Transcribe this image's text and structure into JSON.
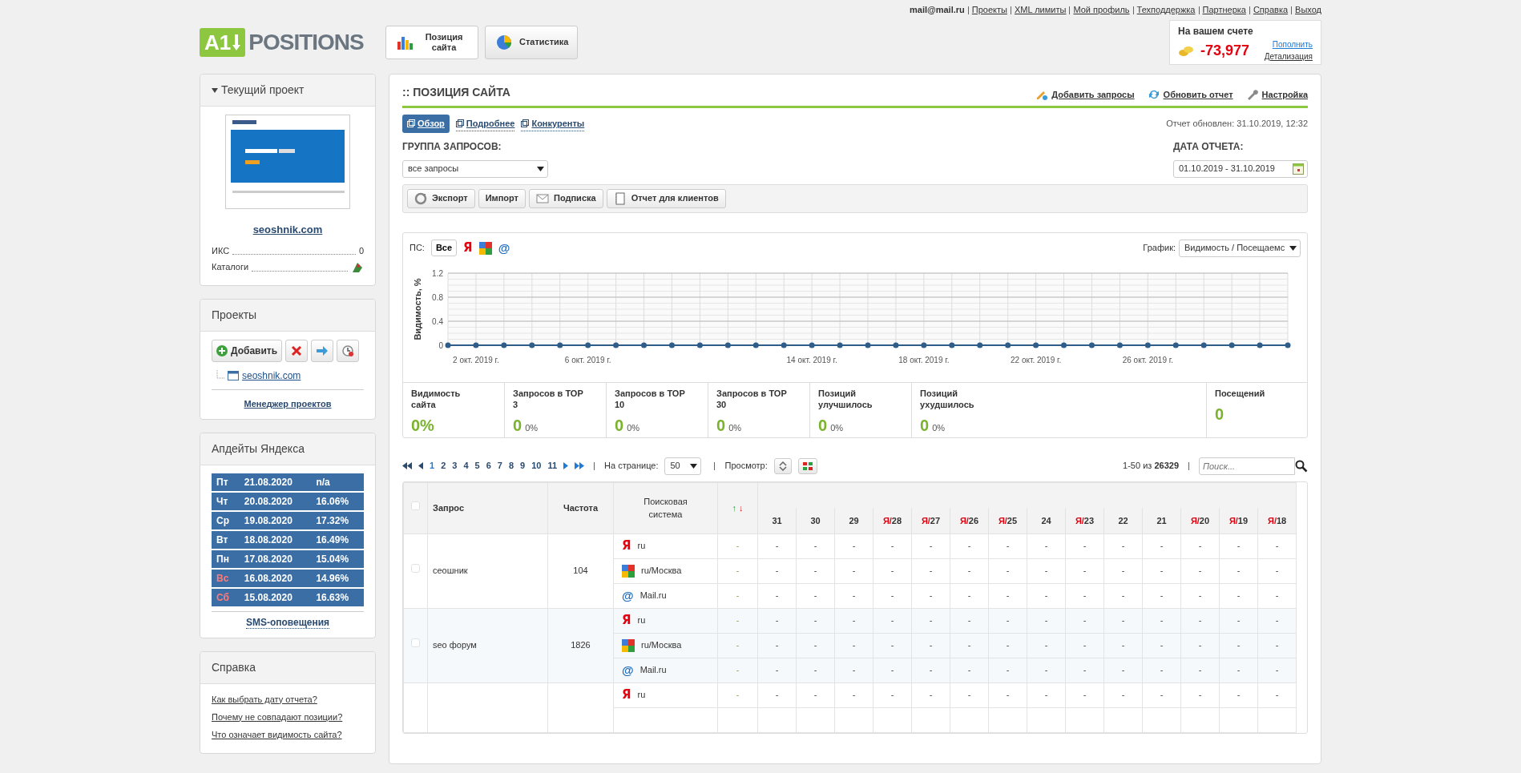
{
  "top_links": {
    "user": "mail@mail.ru",
    "links": [
      "Проекты",
      "XML лимиты",
      "Мой профиль",
      "Техподдержка",
      "Партнерка",
      "Справка",
      "Выход"
    ]
  },
  "logo": {
    "badge": "A1",
    "text": "POSITIONS"
  },
  "nav_tabs": [
    {
      "label": "Позиция сайта",
      "kind": "bars",
      "selected": true
    },
    {
      "label": "Статистика",
      "kind": "pie",
      "selected": false
    }
  ],
  "balance": {
    "title": "На вашем счете",
    "amount": "-73,977",
    "top_up": "Пополнить",
    "details": "Детализация"
  },
  "sidebar": {
    "current_project": {
      "title": "Текущий проект",
      "site": "seoshnik.com",
      "stats": [
        {
          "label": "ИКС",
          "kind": "text",
          "value": "0"
        },
        {
          "label": "Каталоги",
          "kind": "icon"
        }
      ]
    },
    "projects": {
      "title": "Проекты",
      "add": "Добавить",
      "tree": [
        {
          "label": "seoshnik.com"
        }
      ],
      "manager": "Менеджер проектов"
    },
    "updates": {
      "title": "Апдейты Яндекса",
      "rows": [
        {
          "day": "Пт",
          "date": "21.08.2020",
          "value": "n/a",
          "weekend": false
        },
        {
          "day": "Чт",
          "date": "20.08.2020",
          "value": "16.06%",
          "weekend": false
        },
        {
          "day": "Ср",
          "date": "19.08.2020",
          "value": "17.32%",
          "weekend": false
        },
        {
          "day": "Вт",
          "date": "18.08.2020",
          "value": "16.49%",
          "weekend": false
        },
        {
          "day": "Пн",
          "date": "17.08.2020",
          "value": "15.04%",
          "weekend": false
        },
        {
          "day": "Вс",
          "date": "16.08.2020",
          "value": "14.96%",
          "weekend": true
        },
        {
          "day": "Сб",
          "date": "15.08.2020",
          "value": "16.63%",
          "weekend": true
        }
      ],
      "sms": "SMS-оповещения"
    },
    "help": {
      "title": "Справка",
      "links": [
        "Как выбрать дату отчета?",
        "Почему не совпадают позиции?",
        "Что означает видимость сайта?"
      ]
    }
  },
  "main": {
    "title": ":: ПОЗИЦИЯ САЙТА",
    "actions": [
      {
        "label": "Добавить запросы",
        "kind": "add"
      },
      {
        "label": "Обновить отчет",
        "kind": "refresh"
      },
      {
        "label": "Настройка",
        "kind": "settings"
      }
    ],
    "view_tabs": [
      {
        "label": "Обзор",
        "selected": true
      },
      {
        "label": "Подробнее",
        "selected": false
      },
      {
        "label": "Конкуренты",
        "selected": false
      }
    ],
    "updated": "Отчет обновлен: 31.10.2019, 12:32",
    "group_label": "ГРУППА ЗАПРОСОВ:",
    "group_value": "все запросы",
    "date_label": "ДАТА ОТЧЕТА:",
    "date_value": "01.10.2019 - 31.10.2019",
    "toolbar": [
      {
        "label": "Экспорт",
        "kind": "export"
      },
      {
        "label": "Импорт",
        "kind": "plain"
      },
      {
        "label": "Подписка",
        "kind": "mail"
      },
      {
        "label": "Отчет для клиентов",
        "kind": "doc"
      }
    ],
    "chart_panel": {
      "ps_label": "ПС:",
      "engines": [
        {
          "kind": "all",
          "label": "Все",
          "selected": true
        },
        {
          "kind": "yandex",
          "glyph": "Я",
          "selected": false
        },
        {
          "kind": "google",
          "selected": false
        },
        {
          "kind": "mail",
          "glyph": "@",
          "selected": false
        }
      ],
      "graph_label": "График:",
      "graph_value": "Видимость / Посещаемс",
      "chart_data": {
        "type": "line",
        "ylabel": "Видимость, %",
        "categories": [
          null,
          "2 окт. 2019 г.",
          null,
          null,
          null,
          "6 окт. 2019 г.",
          null,
          null,
          null,
          null,
          null,
          null,
          null,
          "14 окт. 2019 г.",
          null,
          null,
          null,
          "18 окт. 2019 г.",
          null,
          null,
          null,
          "22 окт. 2019 г.",
          null,
          null,
          null,
          "26 окт. 2019 г.",
          null,
          null,
          null,
          null,
          null
        ],
        "series": [
          {
            "color": "#2f5d8a",
            "marker": true,
            "values": [
              0,
              0,
              0,
              0,
              0,
              0,
              0,
              0,
              0,
              0,
              0,
              0,
              0,
              0,
              0,
              0,
              0,
              0,
              0,
              0,
              0,
              0,
              0,
              0,
              0,
              0,
              0,
              0,
              0,
              0,
              0
            ]
          }
        ],
        "ylim": [
          0,
          1.2
        ],
        "yticks": [
          0,
          0.4,
          0.8,
          1.2
        ],
        "grid": true
      },
      "stats": [
        {
          "label": "Видимость сайта",
          "value": "0%"
        },
        {
          "label": "Запросов в ТОР 3",
          "value": "0",
          "percent": "0%"
        },
        {
          "label": "Запросов в ТОР 10",
          "value": "0",
          "percent": "0%"
        },
        {
          "label": "Запросов в ТОР 30",
          "value": "0",
          "percent": "0%"
        },
        {
          "label": "Позиций улучшилось",
          "value": "0",
          "percent": "0%"
        },
        {
          "label": "Позиций ухудшилось",
          "value": "0",
          "percent": "0%"
        },
        {
          "label": "Посещений",
          "value": "0"
        }
      ]
    },
    "pagination": {
      "pages": [
        {
          "label": "1",
          "selected": true
        },
        {
          "label": "2",
          "selected": false
        },
        {
          "label": "3",
          "selected": false
        },
        {
          "label": "4",
          "selected": false
        },
        {
          "label": "5",
          "selected": false
        },
        {
          "label": "6",
          "selected": false
        },
        {
          "label": "7",
          "selected": false
        },
        {
          "label": "8",
          "selected": false
        },
        {
          "label": "9",
          "selected": false
        },
        {
          "label": "10",
          "selected": false
        },
        {
          "label": "11",
          "selected": false
        }
      ],
      "per_page_label": "На странице:",
      "per_page": "50",
      "view_label": "Просмотр:",
      "range": "1-50 из **26329**",
      "search_placeholder": "Поиск..."
    },
    "table": {
      "select_all": false,
      "columns": {
        "query": "Запрос",
        "freq": "Частота",
        "engine": "Поисковая система",
        "change_up": "↑",
        "change_down": "↓"
      },
      "days": [
        {
          "day": "31"
        },
        {
          "day": "30"
        },
        {
          "day": "29"
        },
        {
          "prefix": "Я/",
          "day": "28"
        },
        {
          "prefix": "Я/",
          "day": "27"
        },
        {
          "prefix": "Я/",
          "day": "26"
        },
        {
          "prefix": "Я/",
          "day": "25"
        },
        {
          "day": "24"
        },
        {
          "prefix": "Я/",
          "day": "23"
        },
        {
          "day": "22"
        },
        {
          "day": "21"
        },
        {
          "prefix": "Я/",
          "day": "20"
        },
        {
          "prefix": "Я/",
          "day": "19"
        },
        {
          "prefix": "Я/",
          "day": "18"
        }
      ],
      "rows": [
        {
          "query": "сеошник",
          "freq": "104",
          "checked": false,
          "engines": [
            {
              "kind": "yandex",
              "glyph": "Я",
              "region": "ru",
              "change": "-",
              "cells": [
                "-",
                "-",
                "-",
                "-",
                "-",
                "-",
                "-",
                "-",
                "-",
                "-",
                "-",
                "-",
                "-",
                "-"
              ]
            },
            {
              "kind": "google",
              "region": "ru/Москва",
              "change": "-",
              "cells": [
                "-",
                "-",
                "-",
                "-",
                "-",
                "-",
                "-",
                "-",
                "-",
                "-",
                "-",
                "-",
                "-",
                "-"
              ]
            },
            {
              "kind": "mail",
              "glyph": "@",
              "region": "Mail.ru",
              "change": "-",
              "cells": [
                "-",
                "-",
                "-",
                "-",
                "-",
                "-",
                "-",
                "-",
                "-",
                "-",
                "-",
                "-",
                "-",
                "-"
              ]
            }
          ]
        },
        {
          "query": "seo форум",
          "freq": "1826",
          "checked": false,
          "engines": [
            {
              "kind": "yandex",
              "glyph": "Я",
              "region": "ru",
              "change": "-",
              "cells": [
                "-",
                "-",
                "-",
                "-",
                "-",
                "-",
                "-",
                "-",
                "-",
                "-",
                "-",
                "-",
                "-",
                "-"
              ]
            },
            {
              "kind": "google",
              "region": "ru/Москва",
              "change": "-",
              "cells": [
                "-",
                "-",
                "-",
                "-",
                "-",
                "-",
                "-",
                "-",
                "-",
                "-",
                "-",
                "-",
                "-",
                "-"
              ]
            },
            {
              "kind": "mail",
              "glyph": "@",
              "region": "Mail.ru",
              "change": "-",
              "cells": [
                "-",
                "-",
                "-",
                "-",
                "-",
                "-",
                "-",
                "-",
                "-",
                "-",
                "-",
                "-",
                "-",
                "-"
              ]
            }
          ]
        },
        {
          "engines": [
            {
              "kind": "yandex",
              "glyph": "Я",
              "region": "ru",
              "change": "-",
              "cells": [
                "-",
                "-",
                "-",
                "-",
                "-",
                "-",
                "-",
                "-",
                "-",
                "-",
                "-",
                "-",
                "-",
                "-"
              ]
            },
            {
              "kind": "none"
            }
          ]
        }
      ]
    }
  }
}
